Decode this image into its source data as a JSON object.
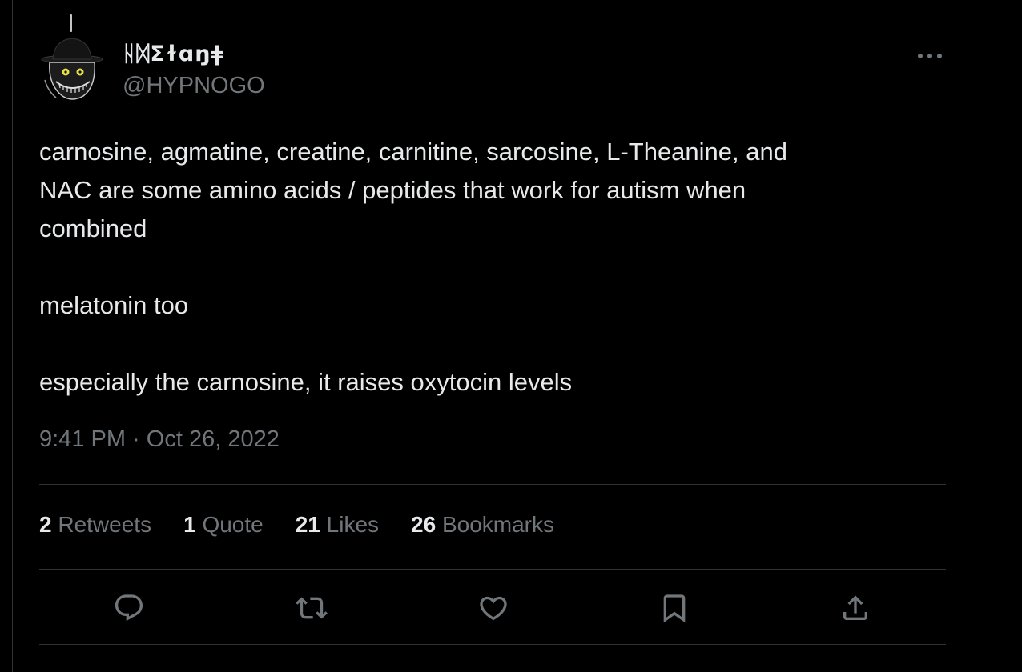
{
  "author": {
    "display_name": "ᚺᛞΣɫɑŋǂ",
    "handle": "@HYPNOGO",
    "avatar_icon": "creepy-hat-face-avatar"
  },
  "tweet": {
    "paragraphs": [
      "carnosine, agmatine, creatine, carnitine, sarcosine, L-Theanine, and\nNAC are some amino acids / peptides that work for autism when\ncombined",
      "melatonin too",
      "especially the carnosine, it raises oxytocin levels"
    ],
    "timestamp": "9:41 PM · Oct 26, 2022"
  },
  "stats": {
    "retweets": {
      "count": "2",
      "label": "Retweets"
    },
    "quotes": {
      "count": "1",
      "label": "Quote"
    },
    "likes": {
      "count": "21",
      "label": "Likes"
    },
    "bookmarks": {
      "count": "26",
      "label": "Bookmarks"
    }
  },
  "actions": {
    "reply": "reply-icon",
    "retweet": "retweet-icon",
    "like": "heart-icon",
    "bookmark": "bookmark-icon",
    "share": "share-icon"
  },
  "colors": {
    "background": "#000000",
    "text_primary": "#e7e9ea",
    "text_secondary": "#71767b",
    "divider": "#2f3336"
  }
}
